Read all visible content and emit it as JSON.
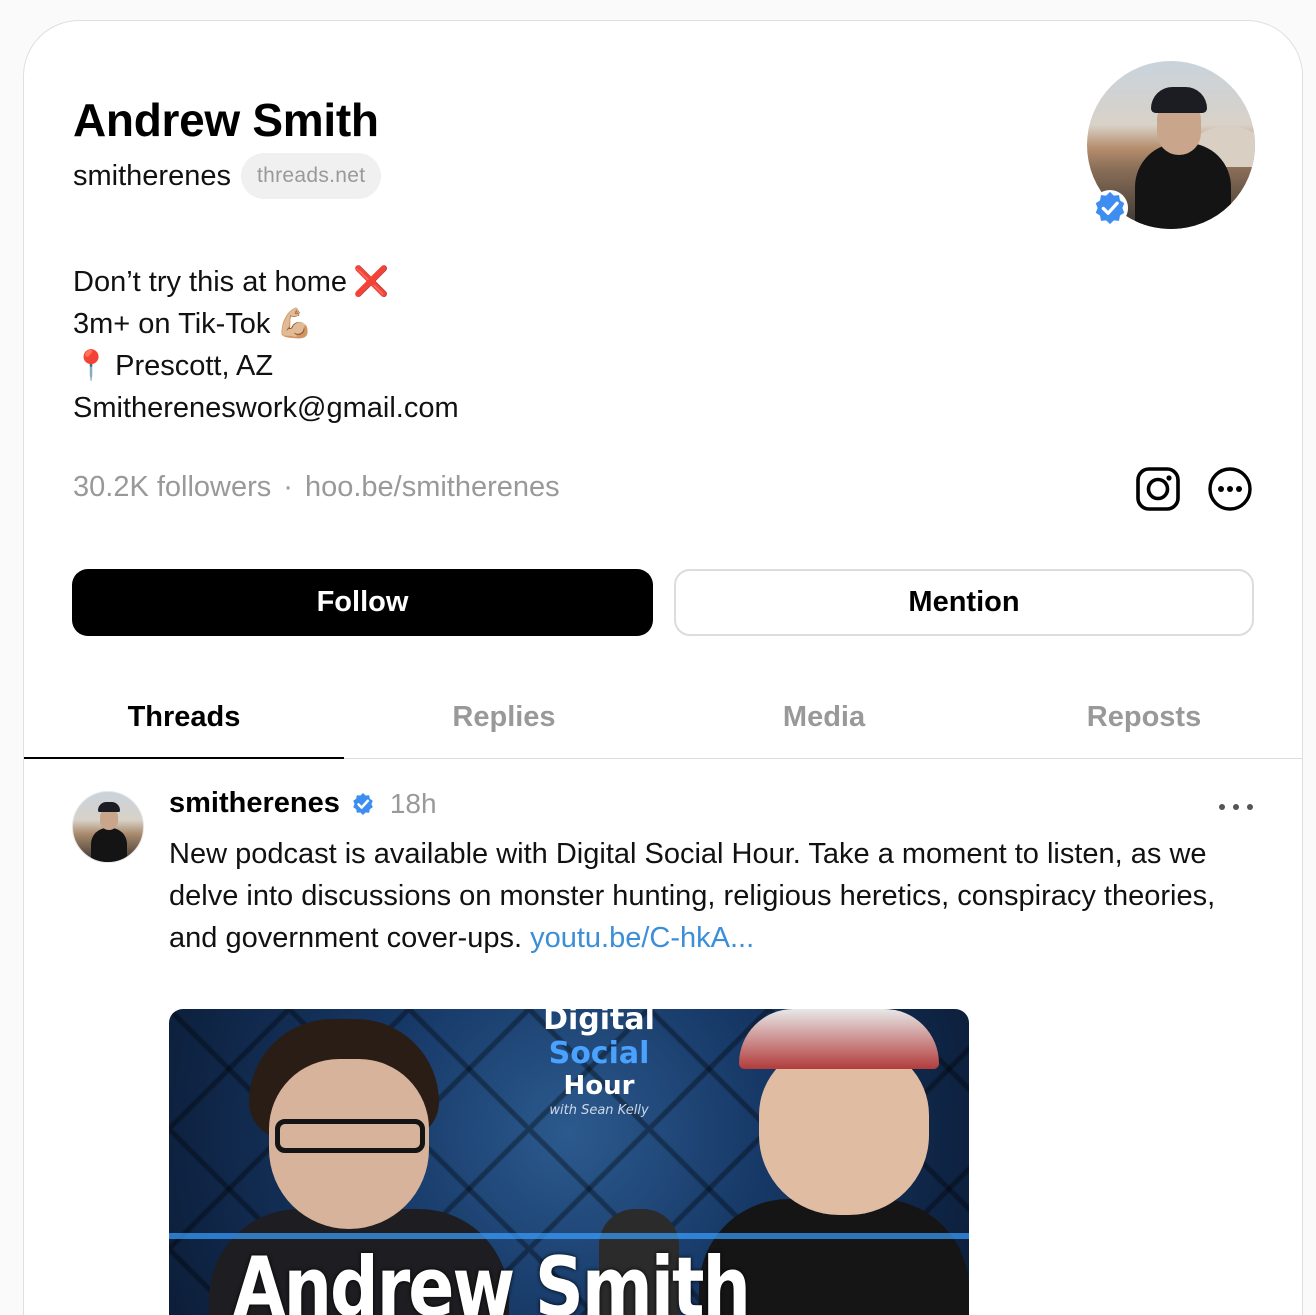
{
  "profile": {
    "name": "Andrew Smith",
    "handle": "smitherenes",
    "domain": "threads.net",
    "verified": true,
    "bio": [
      {
        "text": "Don’t try this at home",
        "emoji": "❌"
      },
      {
        "text": "3m+ on Tik-Tok",
        "emoji": "💪🏼"
      },
      {
        "emoji": "📍",
        "text": "Prescott, AZ"
      },
      {
        "text": "Smithereneswork@gmail.com"
      }
    ],
    "followers": "30.2K followers",
    "separator": "·",
    "link": "hoo.be/smitherenes"
  },
  "icons": {
    "instagram": "instagram-icon",
    "more": "more-options-icon",
    "verified": "verified-badge-icon"
  },
  "actions": {
    "follow_label": "Follow",
    "mention_label": "Mention"
  },
  "tabs": [
    {
      "label": "Threads",
      "active": true
    },
    {
      "label": "Replies",
      "active": false
    },
    {
      "label": "Media",
      "active": false
    },
    {
      "label": "Reposts",
      "active": false
    }
  ],
  "post": {
    "user": "smitherenes",
    "time": "18h",
    "text": "New podcast is available with Digital Social Hour. Take a moment to listen, as we delve into discussions on monster hunting, religious heretics, conspiracy theories, and government cover-ups. ",
    "link": "youtu.be/C-hkA...",
    "media": {
      "brand_line1_a": "Digital",
      "brand_line1_b": "Social",
      "brand_line2": "Hour",
      "brand_line3": "with Sean Kelly",
      "caption": "Andrew Smith"
    }
  },
  "colors": {
    "accent_link": "#3b8ed8",
    "verified_blue": "#3d8ef0",
    "muted_text": "#999999",
    "primary_button": "#000000"
  }
}
